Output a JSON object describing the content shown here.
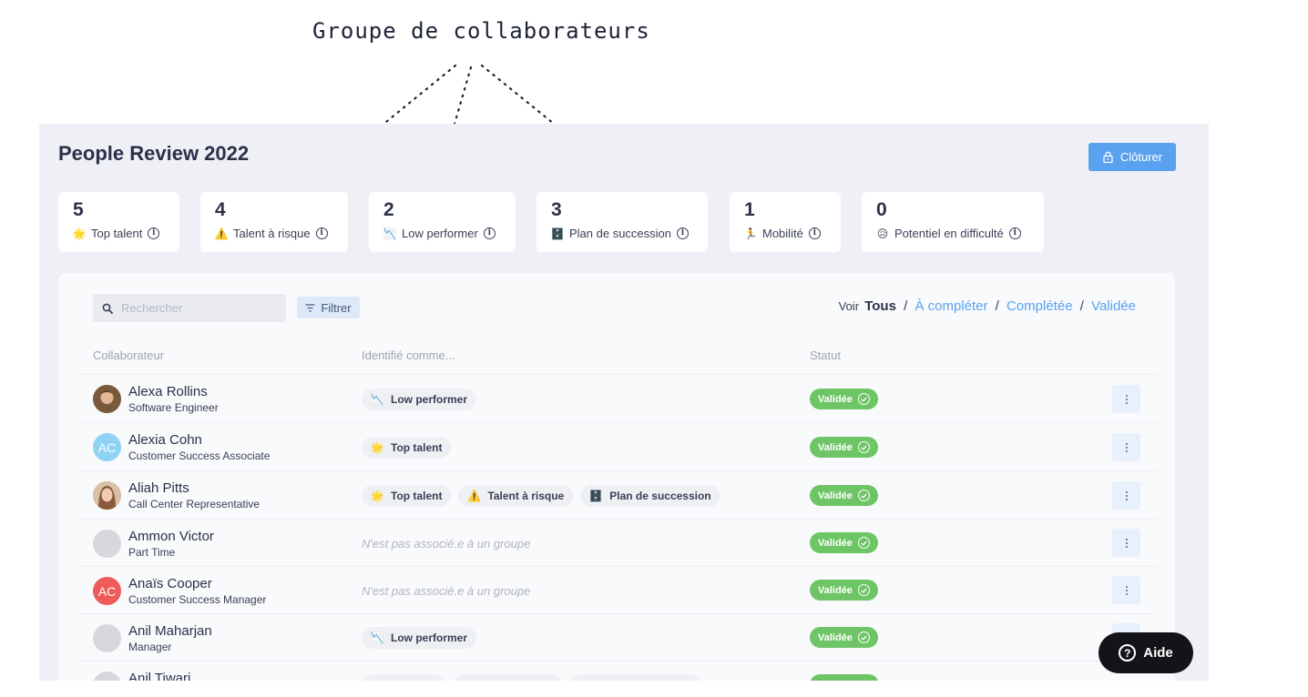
{
  "annotation": {
    "title": "Groupe de collaborateurs"
  },
  "page": {
    "title": "People Review 2022",
    "close_label": "Clôturer"
  },
  "stats": [
    {
      "count": "5",
      "label": "Top talent",
      "icon": "star-icon"
    },
    {
      "count": "4",
      "label": "Talent à risque",
      "icon": "warning-icon"
    },
    {
      "count": "2",
      "label": "Low performer",
      "icon": "chart-down-icon"
    },
    {
      "count": "3",
      "label": "Plan de succession",
      "icon": "succession-icon"
    },
    {
      "count": "1",
      "label": "Mobilité",
      "icon": "running-icon"
    },
    {
      "count": "0",
      "label": "Potentiel en difficulté",
      "icon": "sad-face-icon"
    }
  ],
  "toolbar": {
    "search_placeholder": "Rechercher",
    "filter_label": "Filtrer",
    "view_prefix": "Voir",
    "view_all": "Tous",
    "view_to_complete": "À compléter",
    "view_completed": "Complétée",
    "view_validated": "Validée",
    "separator": "/"
  },
  "table": {
    "headers": {
      "employee": "Collaborateur",
      "identified_as": "Identifié comme...",
      "status": "Statut"
    },
    "no_group_text": "N'est pas associé.e à un groupe",
    "rows": [
      {
        "name": "Alexa Rollins",
        "role": "Software Engineer",
        "tags": [
          "Low performer"
        ],
        "status": "Validée"
      },
      {
        "name": "Alexia Cohn",
        "role": "Customer Success Associate",
        "initials": "AC",
        "tags": [
          "Top talent"
        ],
        "status": "Validée"
      },
      {
        "name": "Aliah Pitts",
        "role": "Call Center Representative",
        "tags": [
          "Top talent",
          "Talent à risque",
          "Plan de succession"
        ],
        "status": "Validée"
      },
      {
        "name": "Ammon Victor",
        "role": "Part Time",
        "tags": [],
        "status": "Validée"
      },
      {
        "name": "Anaïs Cooper",
        "role": "Customer Success Manager",
        "initials": "AC",
        "tags": [],
        "status": "Validée"
      },
      {
        "name": "Anil Maharjan",
        "role": "Manager",
        "tags": [
          "Low performer"
        ],
        "status": "Validée"
      },
      {
        "name": "Anil Tiwari",
        "role": "",
        "tags": [],
        "status": ""
      }
    ]
  },
  "help": {
    "label": "Aide"
  },
  "colors": {
    "accent": "#5aa1ef",
    "validated": "#6dc565",
    "avatar_light_blue": "#8fd3f4",
    "avatar_red": "#ee5b5b",
    "avatar_gray": "#d6d8dc"
  }
}
